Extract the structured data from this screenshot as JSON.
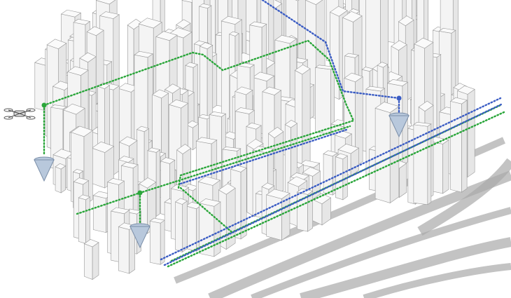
{
  "colors": {
    "background": "#ffffff",
    "building_fill": "#f4f4f4",
    "building_stroke": "#9a9a9a",
    "road": "#a9a9a9",
    "route_green": "#2aa63a",
    "route_blue": "#3a5cc4",
    "cone_fill": "#b8c8dc",
    "drone": "#555555"
  },
  "icons": [
    "drone-icon",
    "cone-marker-icon"
  ]
}
